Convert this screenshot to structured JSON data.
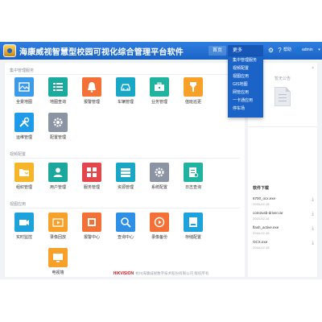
{
  "header": {
    "title": "海康威视智慧型校园可视化综合管理平台软件",
    "nav_home": "首页",
    "nav_more": "更多",
    "help_label": "帮助",
    "user_label": "admin"
  },
  "more_menu": [
    "集中管理服务",
    "视频配置",
    "视图应用",
    "GIS地图",
    "网管应用",
    "一卡通应用",
    "停车场"
  ],
  "sections": [
    {
      "title": "集中管理服务",
      "tiles": [
        {
          "label": "全景地图",
          "icon": "map-icon",
          "color": "#3b9be8"
        },
        {
          "label": "地图查询",
          "icon": "list-icon",
          "color": "#1aaa9e"
        },
        {
          "label": "报警管理",
          "icon": "alarm-icon",
          "color": "#f37036"
        },
        {
          "label": "车辆管理",
          "icon": "car-icon",
          "color": "#19a7c6"
        },
        {
          "label": "业务管理",
          "icon": "briefcase-icon",
          "color": "#20b3a0"
        },
        {
          "label": "值班巡更",
          "icon": "torch-icon",
          "color": "#f7a02a"
        },
        {
          "label": "运维管理",
          "icon": "tools-icon",
          "color": "#1e9ce9"
        },
        {
          "label": "配置管理",
          "icon": "gear-icon",
          "color": "#8a94a3"
        }
      ]
    },
    {
      "title": "视频配置",
      "tiles": [
        {
          "label": "组织管理",
          "icon": "folder-icon",
          "color": "#f7b52a"
        },
        {
          "label": "用户管理",
          "icon": "user-icon",
          "color": "#1aa79d"
        },
        {
          "label": "服务管理",
          "icon": "grid-icon",
          "color": "#e4474b"
        },
        {
          "label": "资源管理",
          "icon": "server-icon",
          "color": "#19a7c6"
        },
        {
          "label": "系统配置",
          "icon": "gear-icon",
          "color": "#8a94a3"
        },
        {
          "label": "日志查询",
          "icon": "log-icon",
          "color": "#20b3a0"
        }
      ]
    },
    {
      "title": "视图应用",
      "tiles": [
        {
          "label": "实时监控",
          "icon": "camera-icon",
          "color": "#1ea2dc"
        },
        {
          "label": "录像回放",
          "icon": "playback-icon",
          "color": "#f7a02a"
        },
        {
          "label": "报警中心",
          "icon": "alarm-center-icon",
          "color": "#f37036"
        },
        {
          "label": "查询中心",
          "icon": "search-icon",
          "color": "#2e8fe6"
        },
        {
          "label": "录像备份",
          "icon": "backup-icon",
          "color": "#f37036"
        },
        {
          "label": "存储配置",
          "icon": "storage-icon",
          "color": "#1ea2dc"
        },
        {
          "label": "电视墙",
          "icon": "tv-icon",
          "color": "#f7a02a"
        }
      ]
    }
  ],
  "right_panel": {
    "close_label": "×",
    "mini_title": "暂无公告",
    "downloads_title": "软件下载",
    "downloads": [
      {
        "name": "6700_ocx.exe",
        "date": "2016-02-15"
      },
      {
        "name": "com2usb-driver.rar",
        "date": "2016-02-15"
      },
      {
        "name": "flash_active.exe",
        "date": "2016-02-15"
      },
      {
        "name": "OCX.exe",
        "date": "2016-02-15"
      }
    ]
  },
  "footer": {
    "brand": "HIKVISION",
    "text": "杭州海康威视数字技术股份有限公司 版权所有"
  }
}
